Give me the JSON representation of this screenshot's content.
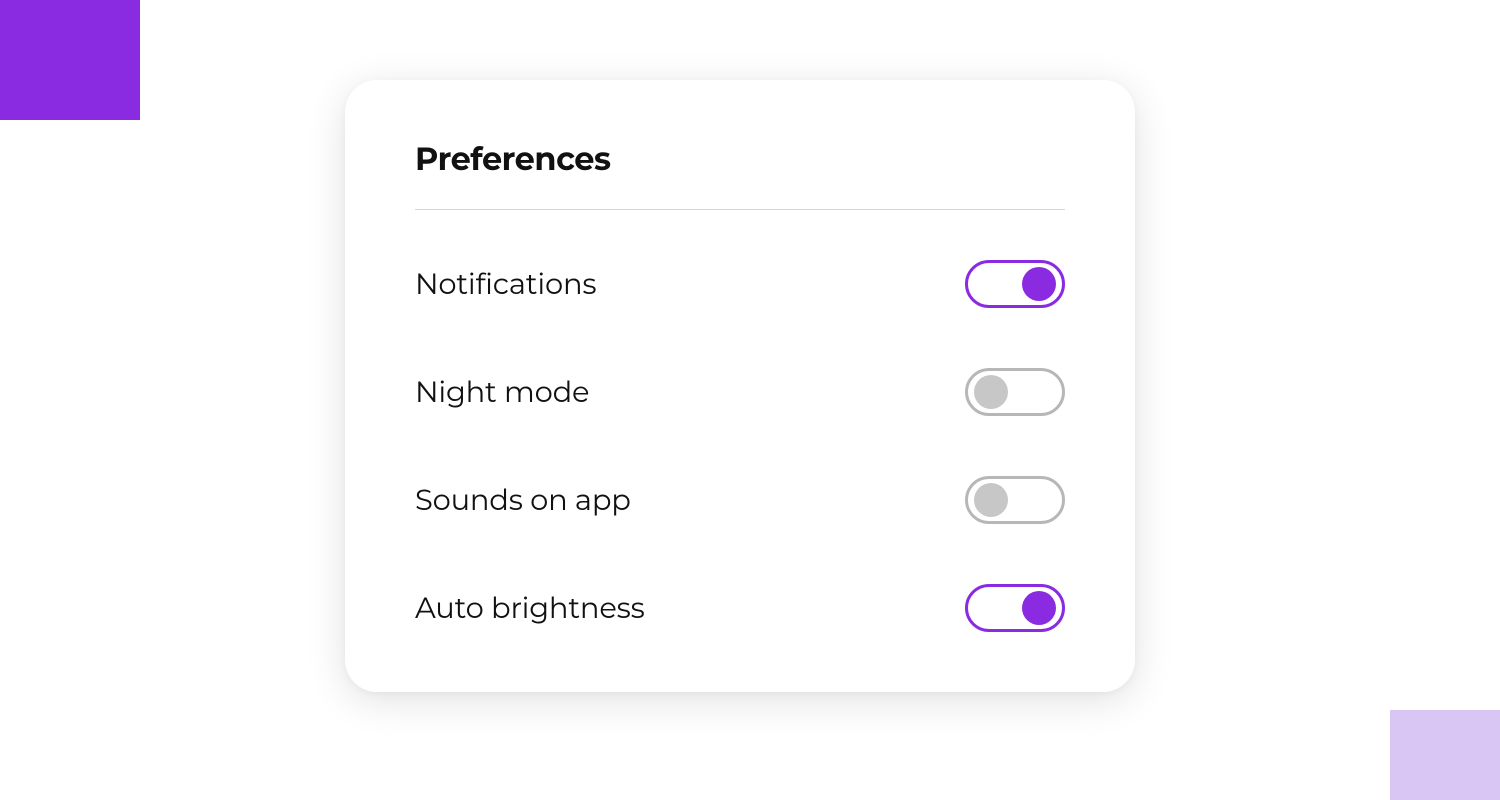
{
  "card": {
    "title": "Preferences"
  },
  "preferences": [
    {
      "label": "Notifications",
      "on": true
    },
    {
      "label": "Night mode",
      "on": false
    },
    {
      "label": "Sounds on app",
      "on": false
    },
    {
      "label": "Auto brightness",
      "on": true
    }
  ],
  "colors": {
    "accent": "#8a2be2",
    "decorLight": "#d9c6f5",
    "toggleOffBorder": "#b7b7b7",
    "toggleOffKnob": "#c7c7c7"
  }
}
